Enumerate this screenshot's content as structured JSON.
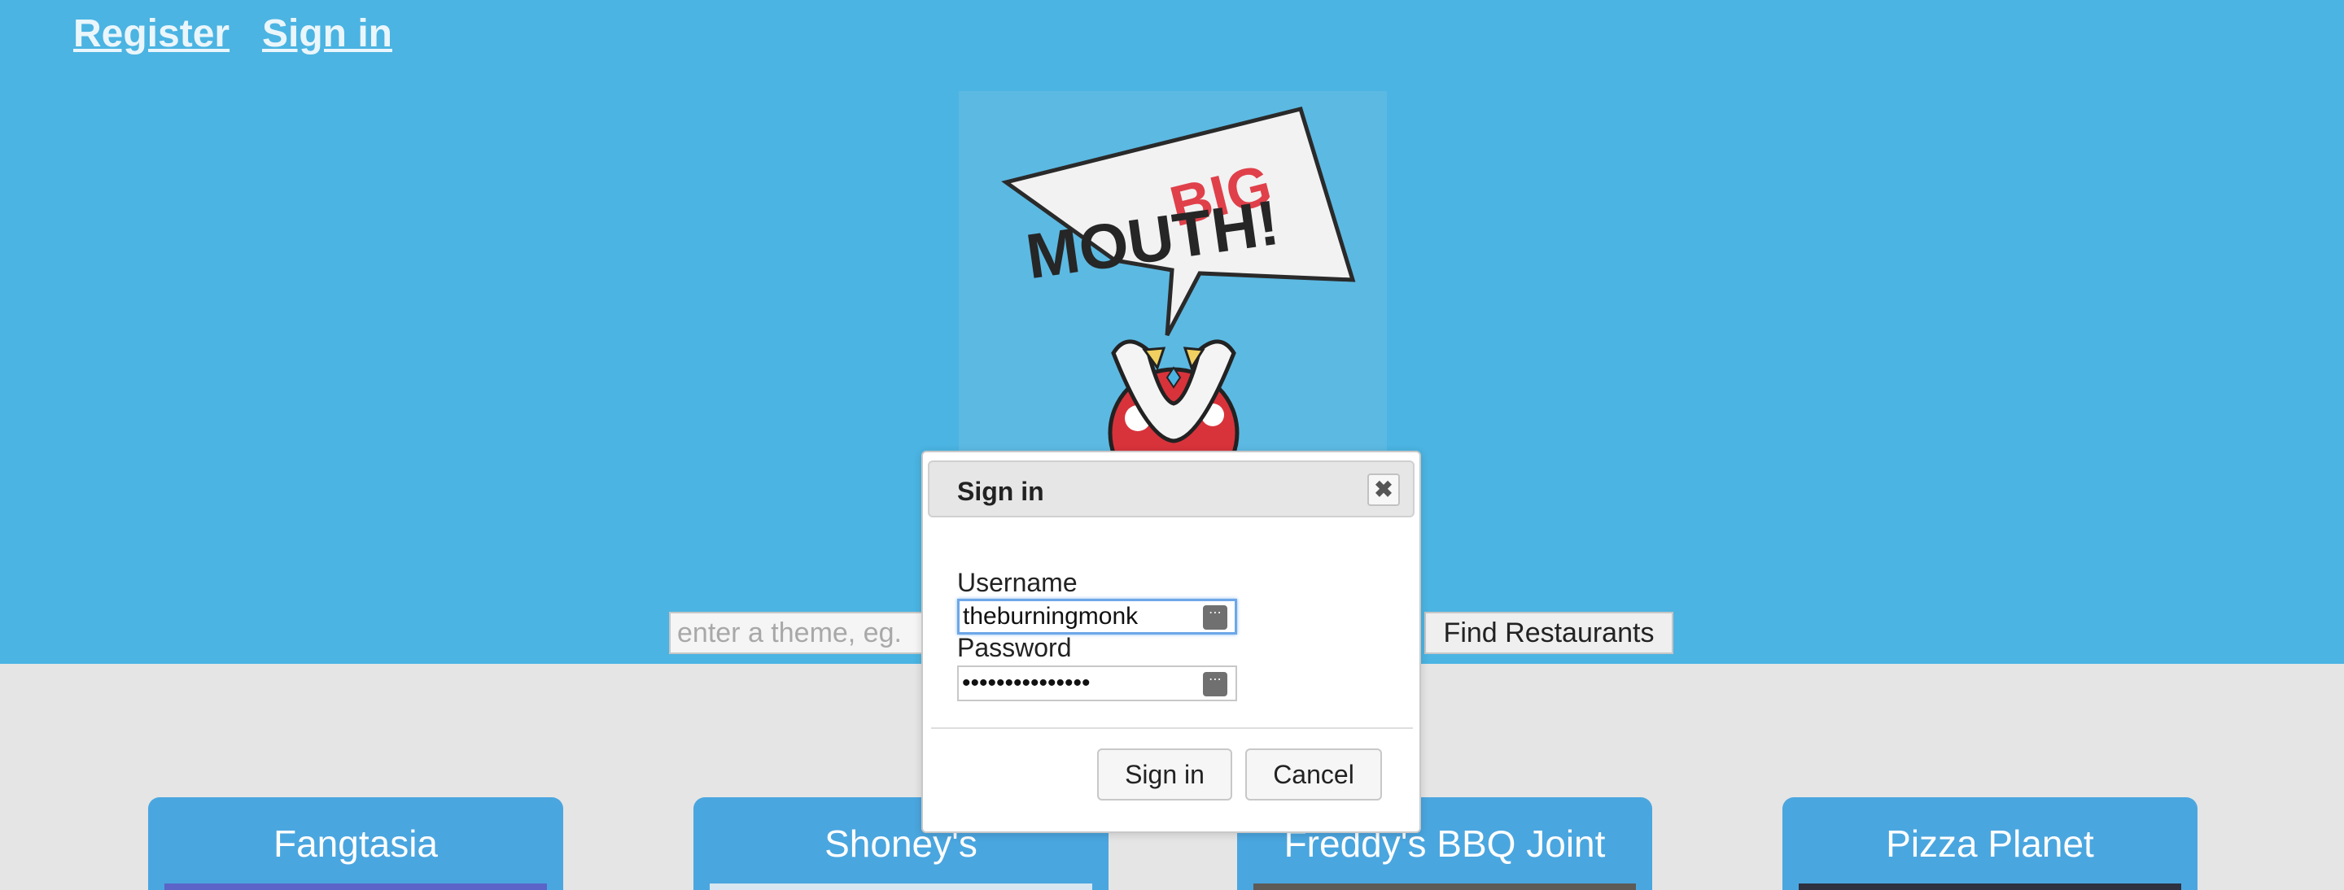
{
  "nav": {
    "register": "Register",
    "signin": "Sign in"
  },
  "logo": {
    "big_text": "BIG",
    "mouth_text": "MOUTH!",
    "alt": "Big Mouth logo"
  },
  "search": {
    "placeholder": "enter a theme, eg.",
    "button_label": "Find Restaurants"
  },
  "restaurants": [
    {
      "name": "Fangtasia"
    },
    {
      "name": "Shoney's"
    },
    {
      "name": "Freddy's BBQ Joint"
    },
    {
      "name": "Pizza Planet"
    }
  ],
  "dialog": {
    "title": "Sign in",
    "close_glyph": "✖",
    "username_label": "Username",
    "username_value": "theburningmonk",
    "password_label": "Password",
    "password_value": "•••••••••••••••",
    "signin_button": "Sign in",
    "cancel_button": "Cancel",
    "pw_icon_glyph": "⋯"
  },
  "colors": {
    "hero_bg": "#4bb4e2",
    "card_bg": "#4aa6df",
    "page_bg": "#e5e5e5",
    "logo_red": "#e0404a"
  }
}
